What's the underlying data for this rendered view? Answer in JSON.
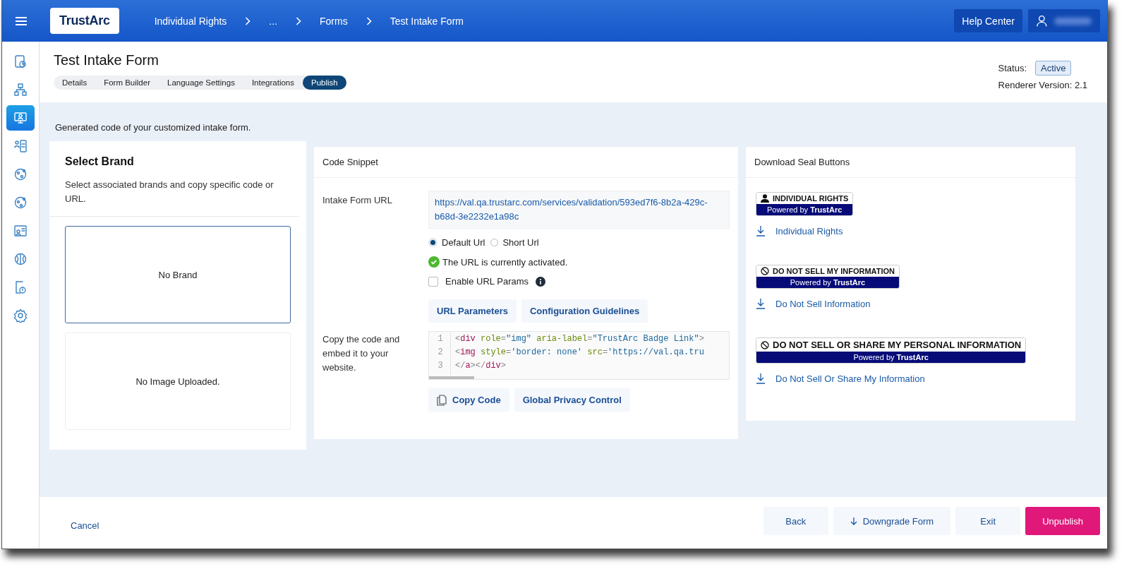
{
  "top_bar": {
    "logo": "TrustArc",
    "breadcrumbs": [
      "Individual Rights",
      "...",
      "Forms",
      "Test Intake Form"
    ],
    "help_button": "Help Center"
  },
  "sidebar": {
    "items": [
      {
        "selected": false
      },
      {
        "selected": false
      },
      {
        "selected": true
      },
      {
        "selected": false
      },
      {
        "selected": false
      },
      {
        "selected": false
      },
      {
        "selected": false
      },
      {
        "selected": false
      },
      {
        "selected": false
      },
      {
        "selected": false
      }
    ]
  },
  "header": {
    "title": "Test Intake Form",
    "tabs": [
      {
        "label": "Details",
        "selected": false
      },
      {
        "label": "Form Builder",
        "selected": false
      },
      {
        "label": "Language Settings",
        "selected": false
      },
      {
        "label": "Integrations",
        "selected": false
      },
      {
        "label": "Publish",
        "selected": true
      }
    ],
    "status_label": "Status:",
    "status": "Active",
    "renderer_version": "Renderer Version: 2.1"
  },
  "intro": "Generated code of your customized intake form.",
  "brand_panel": {
    "title": "Select Brand",
    "description": "Select associated brands and copy specific code or URL.",
    "options": [
      {
        "label": "No Brand",
        "selected": true
      },
      {
        "label": "No Image Uploaded.",
        "selected": false
      }
    ]
  },
  "code_snippet": {
    "title": "Code Snippet",
    "url_label": "Intake Form URL",
    "url": "https://val.qa.trustarc.com/services/validation/593ed7f6-8b2a-429c-b68d-3e2232e1a98c",
    "url_types": [
      {
        "label": "Default Url",
        "selected": true
      },
      {
        "label": "Short Url",
        "selected": false
      }
    ],
    "activation_message": "The URL is currently activated.",
    "enable_params": {
      "label": "Enable URL Params",
      "checked": false
    },
    "link_buttons": [
      "URL Parameters",
      "Configuration Guidelines"
    ],
    "code_label": "Copy the code and embed it to your website.",
    "code_lines": [
      {
        "number": "1",
        "tokens": [
          {
            "kind": "punct",
            "text": "<"
          },
          {
            "kind": "tag",
            "text": "div"
          },
          {
            "kind": "attr",
            "text": " role"
          },
          {
            "kind": "punct",
            "text": "="
          },
          {
            "kind": "str",
            "text": "\"img\""
          },
          {
            "kind": "attr",
            "text": " aria-label"
          },
          {
            "kind": "punct",
            "text": "="
          },
          {
            "kind": "str",
            "text": "\"TrustArc Badge Link\""
          },
          {
            "kind": "punct",
            "text": ">"
          }
        ]
      },
      {
        "number": "2",
        "tokens": [
          {
            "kind": "punct",
            "text": "<"
          },
          {
            "kind": "tag",
            "text": "img"
          },
          {
            "kind": "attr",
            "text": " style"
          },
          {
            "kind": "punct",
            "text": "="
          },
          {
            "kind": "str",
            "text": "'border: none'"
          },
          {
            "kind": "attr",
            "text": " src"
          },
          {
            "kind": "punct",
            "text": "="
          },
          {
            "kind": "str",
            "text": "'https://val.qa.tru"
          }
        ]
      },
      {
        "number": "3",
        "tokens": [
          {
            "kind": "punct",
            "text": "</"
          },
          {
            "kind": "tag",
            "text": "a"
          },
          {
            "kind": "punct",
            "text": "></"
          },
          {
            "kind": "tag",
            "text": "div"
          },
          {
            "kind": "punct",
            "text": ">"
          }
        ]
      }
    ],
    "copy_button": "Copy Code",
    "gpc_button": "Global Privacy Control"
  },
  "seal_panel": {
    "title": "Download Seal Buttons",
    "seals": [
      {
        "kind": "person",
        "badge": "INDIVIDUAL RIGHTS",
        "powered_by": "Powered by **TrustArc**",
        "download": "Individual Rights"
      },
      {
        "kind": "block",
        "badge": "DO NOT SELL MY INFORMATION",
        "powered_by": "Powered by **TrustArc**",
        "download": "Do Not Sell Information"
      },
      {
        "kind": "block",
        "badge": "DO NOT SELL OR SHARE MY PERSONAL INFORMATION",
        "powered_by": "Powered by **TrustArc**",
        "download": "Do Not Sell Or Share My Information"
      }
    ]
  },
  "footer": {
    "cancel": "Cancel",
    "buttons": [
      {
        "label": "Back",
        "kind": "plain"
      },
      {
        "label": "Downgrade Form",
        "kind": "downgrade"
      },
      {
        "label": "Exit",
        "kind": "plain"
      },
      {
        "label": "Unpublish",
        "kind": "primary"
      }
    ]
  }
}
